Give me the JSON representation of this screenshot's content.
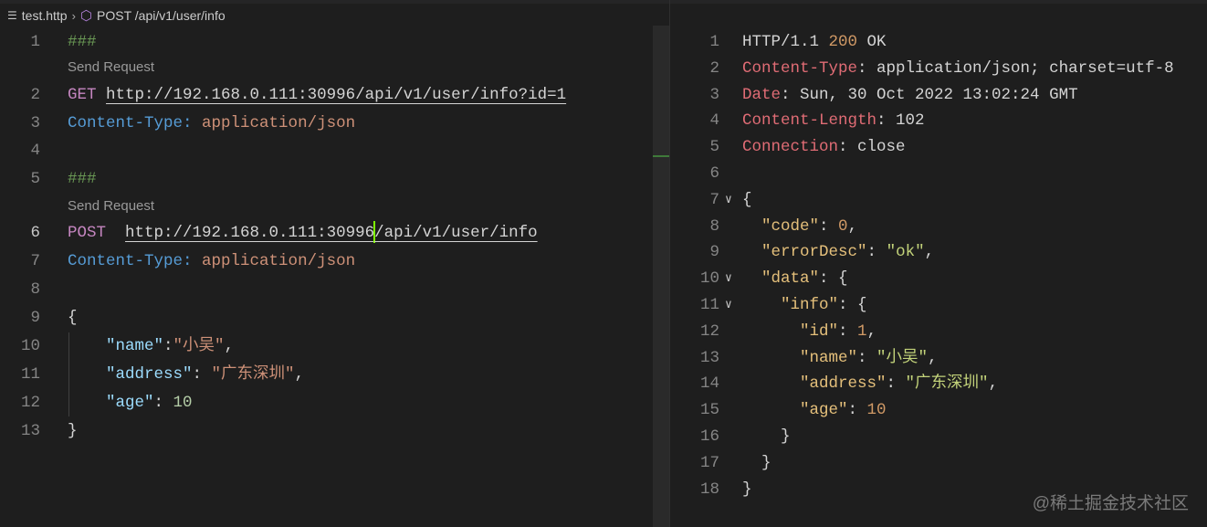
{
  "breadcrumb": {
    "file": "test.http",
    "symbol": "POST /api/v1/user/info"
  },
  "request": {
    "lines": [
      {
        "n": "1",
        "tokens": [
          {
            "t": "###",
            "c": "t-comment"
          }
        ]
      },
      {
        "lens": "Send Request"
      },
      {
        "n": "2",
        "tokens": [
          {
            "t": "GET",
            "c": "t-method"
          },
          {
            "t": " ",
            "c": "t-punc"
          },
          {
            "t": "http://192.168.0.111:30996/api/v1/user/info?id=1",
            "c": "t-url"
          }
        ]
      },
      {
        "n": "3",
        "tokens": [
          {
            "t": "Content-Type:",
            "c": "t-hname"
          },
          {
            "t": " ",
            "c": "t-punc"
          },
          {
            "t": "application/json",
            "c": "t-hval"
          }
        ]
      },
      {
        "n": "4",
        "tokens": []
      },
      {
        "n": "5",
        "tokens": [
          {
            "t": "###",
            "c": "t-comment"
          }
        ]
      },
      {
        "lens": "Send Request"
      },
      {
        "n": "6",
        "active": true,
        "tokens": [
          {
            "t": "POST",
            "c": "t-method"
          },
          {
            "t": "  ",
            "c": "t-punc"
          },
          {
            "t": "http://192.168.0.111:30996",
            "c": "t-url"
          },
          {
            "cursor": true
          },
          {
            "t": "/api/v1/user/info",
            "c": "t-url"
          }
        ]
      },
      {
        "n": "7",
        "tokens": [
          {
            "t": "Content-Type:",
            "c": "t-hname"
          },
          {
            "t": " ",
            "c": "t-punc"
          },
          {
            "t": "application/json",
            "c": "t-hval"
          }
        ]
      },
      {
        "n": "8",
        "tokens": []
      },
      {
        "n": "9",
        "tokens": [
          {
            "t": "{",
            "c": "t-punc"
          }
        ]
      },
      {
        "n": "10",
        "tokens": [
          {
            "t": "    ",
            "c": "t-punc"
          },
          {
            "t": "\"name\"",
            "c": "t-key"
          },
          {
            "t": ":",
            "c": "t-punc"
          },
          {
            "t": "\"小吴\"",
            "c": "t-str"
          },
          {
            "t": ",",
            "c": "t-punc"
          }
        ]
      },
      {
        "n": "11",
        "tokens": [
          {
            "t": "    ",
            "c": "t-punc"
          },
          {
            "t": "\"address\"",
            "c": "t-key"
          },
          {
            "t": ": ",
            "c": "t-punc"
          },
          {
            "t": "\"广东深圳\"",
            "c": "t-str"
          },
          {
            "t": ",",
            "c": "t-punc"
          }
        ]
      },
      {
        "n": "12",
        "tokens": [
          {
            "t": "    ",
            "c": "t-punc"
          },
          {
            "t": "\"age\"",
            "c": "t-key"
          },
          {
            "t": ": ",
            "c": "t-punc"
          },
          {
            "t": "10",
            "c": "t-num"
          }
        ]
      },
      {
        "n": "13",
        "tokens": [
          {
            "t": "}",
            "c": "t-punc"
          }
        ]
      }
    ]
  },
  "response": {
    "lines": [
      {
        "n": "1",
        "tokens": [
          {
            "t": "HTTP/1.1 ",
            "c": "r-plain"
          },
          {
            "t": "200",
            "c": "r-num"
          },
          {
            "t": " OK",
            "c": "r-plain"
          }
        ]
      },
      {
        "n": "2",
        "tokens": [
          {
            "t": "Content-Type",
            "c": "r-hname"
          },
          {
            "t": ": application/json; charset=utf-8",
            "c": "r-plain"
          }
        ]
      },
      {
        "n": "3",
        "tokens": [
          {
            "t": "Date",
            "c": "r-hname"
          },
          {
            "t": ": Sun, 30 Oct 2022 13:02:24 GMT",
            "c": "r-plain"
          }
        ]
      },
      {
        "n": "4",
        "tokens": [
          {
            "t": "Content-Length",
            "c": "r-hname"
          },
          {
            "t": ": 102",
            "c": "r-plain"
          }
        ]
      },
      {
        "n": "5",
        "tokens": [
          {
            "t": "Connection",
            "c": "r-hname"
          },
          {
            "t": ": close",
            "c": "r-plain"
          }
        ]
      },
      {
        "n": "6",
        "tokens": []
      },
      {
        "n": "7",
        "fold": true,
        "tokens": [
          {
            "t": "{",
            "c": "r-plain"
          }
        ]
      },
      {
        "n": "8",
        "tokens": [
          {
            "t": "  ",
            "c": "r-plain"
          },
          {
            "t": "\"code\"",
            "c": "r-key"
          },
          {
            "t": ": ",
            "c": "r-plain"
          },
          {
            "t": "0",
            "c": "r-num"
          },
          {
            "t": ",",
            "c": "r-plain"
          }
        ]
      },
      {
        "n": "9",
        "tokens": [
          {
            "t": "  ",
            "c": "r-plain"
          },
          {
            "t": "\"errorDesc\"",
            "c": "r-key"
          },
          {
            "t": ": ",
            "c": "r-plain"
          },
          {
            "t": "\"ok\"",
            "c": "r-str"
          },
          {
            "t": ",",
            "c": "r-plain"
          }
        ]
      },
      {
        "n": "10",
        "fold": true,
        "tokens": [
          {
            "t": "  ",
            "c": "r-plain"
          },
          {
            "t": "\"data\"",
            "c": "r-key"
          },
          {
            "t": ": {",
            "c": "r-plain"
          }
        ]
      },
      {
        "n": "11",
        "fold": true,
        "tokens": [
          {
            "t": "    ",
            "c": "r-plain"
          },
          {
            "t": "\"info\"",
            "c": "r-key"
          },
          {
            "t": ": {",
            "c": "r-plain"
          }
        ]
      },
      {
        "n": "12",
        "tokens": [
          {
            "t": "      ",
            "c": "r-plain"
          },
          {
            "t": "\"id\"",
            "c": "r-key"
          },
          {
            "t": ": ",
            "c": "r-plain"
          },
          {
            "t": "1",
            "c": "r-num"
          },
          {
            "t": ",",
            "c": "r-plain"
          }
        ]
      },
      {
        "n": "13",
        "tokens": [
          {
            "t": "      ",
            "c": "r-plain"
          },
          {
            "t": "\"name\"",
            "c": "r-key"
          },
          {
            "t": ": ",
            "c": "r-plain"
          },
          {
            "t": "\"小吴\"",
            "c": "r-str"
          },
          {
            "t": ",",
            "c": "r-plain"
          }
        ]
      },
      {
        "n": "14",
        "tokens": [
          {
            "t": "      ",
            "c": "r-plain"
          },
          {
            "t": "\"address\"",
            "c": "r-key"
          },
          {
            "t": ": ",
            "c": "r-plain"
          },
          {
            "t": "\"广东深圳\"",
            "c": "r-str"
          },
          {
            "t": ",",
            "c": "r-plain"
          }
        ]
      },
      {
        "n": "15",
        "tokens": [
          {
            "t": "      ",
            "c": "r-plain"
          },
          {
            "t": "\"age\"",
            "c": "r-key"
          },
          {
            "t": ": ",
            "c": "r-plain"
          },
          {
            "t": "10",
            "c": "r-num"
          }
        ]
      },
      {
        "n": "16",
        "tokens": [
          {
            "t": "    }",
            "c": "r-plain"
          }
        ]
      },
      {
        "n": "17",
        "tokens": [
          {
            "t": "  }",
            "c": "r-plain"
          }
        ]
      },
      {
        "n": "18",
        "tokens": [
          {
            "t": "}",
            "c": "r-plain"
          }
        ]
      }
    ]
  },
  "watermark": "@稀土掘金技术社区"
}
